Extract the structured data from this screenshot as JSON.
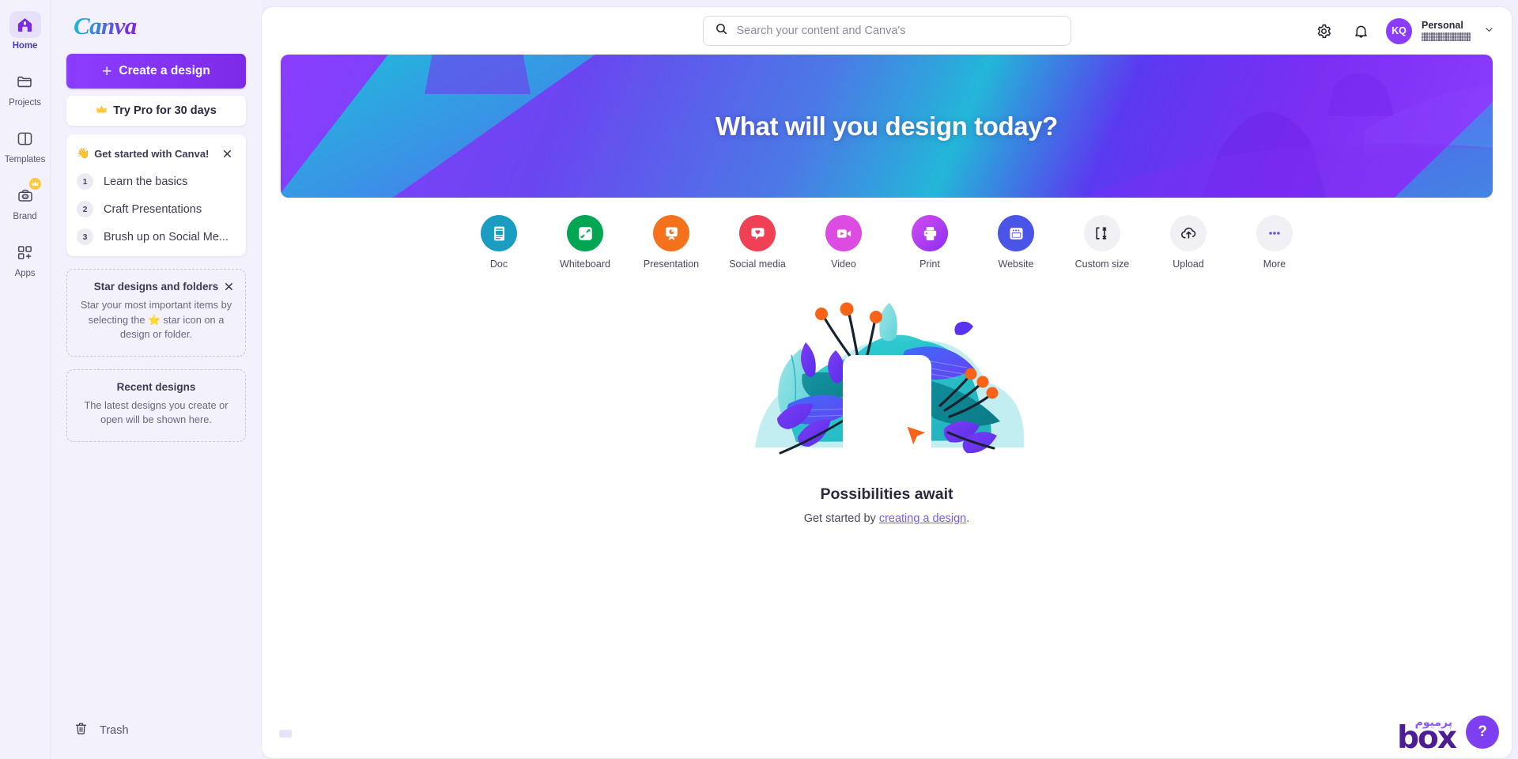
{
  "brand": {
    "logo_text": "Canva"
  },
  "rail": {
    "items": [
      {
        "label": "Home",
        "icon": "home-icon",
        "active": true
      },
      {
        "label": "Projects",
        "icon": "folder-icon",
        "active": false
      },
      {
        "label": "Templates",
        "icon": "templates-icon",
        "active": false
      },
      {
        "label": "Brand",
        "icon": "brand-kit-icon",
        "active": false,
        "badge": "crown-icon"
      },
      {
        "label": "Apps",
        "icon": "apps-grid-plus-icon",
        "active": false
      }
    ]
  },
  "sidebar": {
    "create_button": "Create a design",
    "create_icon": "plus-icon",
    "pro_button": "Try Pro for 30 days",
    "pro_icon": "crown-icon",
    "get_started": {
      "emoji": "👋",
      "title": "Get started with Canva!",
      "close_icon": "close-icon",
      "items": [
        {
          "num": "1",
          "label": "Learn the basics"
        },
        {
          "num": "2",
          "label": "Craft Presentations"
        },
        {
          "num": "3",
          "label": "Brush up on Social Me..."
        }
      ]
    },
    "star_card": {
      "title": "Star designs and folders",
      "body": "Star your most important items by selecting the ⭐ star icon on a design or folder.",
      "close_icon": "close-icon"
    },
    "recent_card": {
      "title": "Recent designs",
      "body": "The latest designs you create or open will be shown here."
    },
    "trash": {
      "label": "Trash",
      "icon": "trash-icon"
    }
  },
  "header": {
    "search": {
      "placeholder": "Search your content and Canva's",
      "value": "",
      "icon": "search-icon"
    },
    "settings_icon": "gear-icon",
    "notifications_icon": "bell-icon",
    "avatar_initials": "KQ",
    "account_name": "Personal",
    "account_email_redacted": true,
    "chevron_icon": "chevron-down-icon"
  },
  "hero": {
    "title": "What will you design today?",
    "gradient_from": "#8b3dff",
    "gradient_teal": "#23b6d8",
    "gradient_to": "#7b2ff2"
  },
  "categories": [
    {
      "label": "Doc",
      "icon": "doc-icon",
      "color": "#1b9dc1",
      "dark": false
    },
    {
      "label": "Whiteboard",
      "icon": "whiteboard-icon",
      "color": "#00a651",
      "dark": false
    },
    {
      "label": "Presentation",
      "icon": "presentation-icon",
      "color": "#f5721d",
      "dark": false
    },
    {
      "label": "Social media",
      "icon": "social-media-icon",
      "color": "#ef4056",
      "dark": false
    },
    {
      "label": "Video",
      "icon": "video-icon",
      "color": "#dc4ce0",
      "dark": false
    },
    {
      "label": "Print",
      "icon": "print-icon",
      "color": "#a43df0",
      "dark": false
    },
    {
      "label": "Website",
      "icon": "website-icon",
      "color": "#4a55e8",
      "dark": false
    },
    {
      "label": "Custom size",
      "icon": "custom-size-icon",
      "color": "#f1f0f5",
      "dark": true
    },
    {
      "label": "Upload",
      "icon": "upload-icon",
      "color": "#f1f0f5",
      "dark": true
    },
    {
      "label": "More",
      "icon": "more-dots-icon",
      "color": "#f1f0f5",
      "dark": true
    }
  ],
  "empty_state": {
    "illustration": "botanical-design-card-illustration",
    "title": "Possibilities await",
    "subtitle_prefix": "Get started by ",
    "link_text": "creating a design",
    "subtitle_suffix": "."
  },
  "footer_brand": {
    "logo_persian": "پرمیوم",
    "logo_main": "box",
    "help_label": "?",
    "help_icon": "help-icon"
  }
}
